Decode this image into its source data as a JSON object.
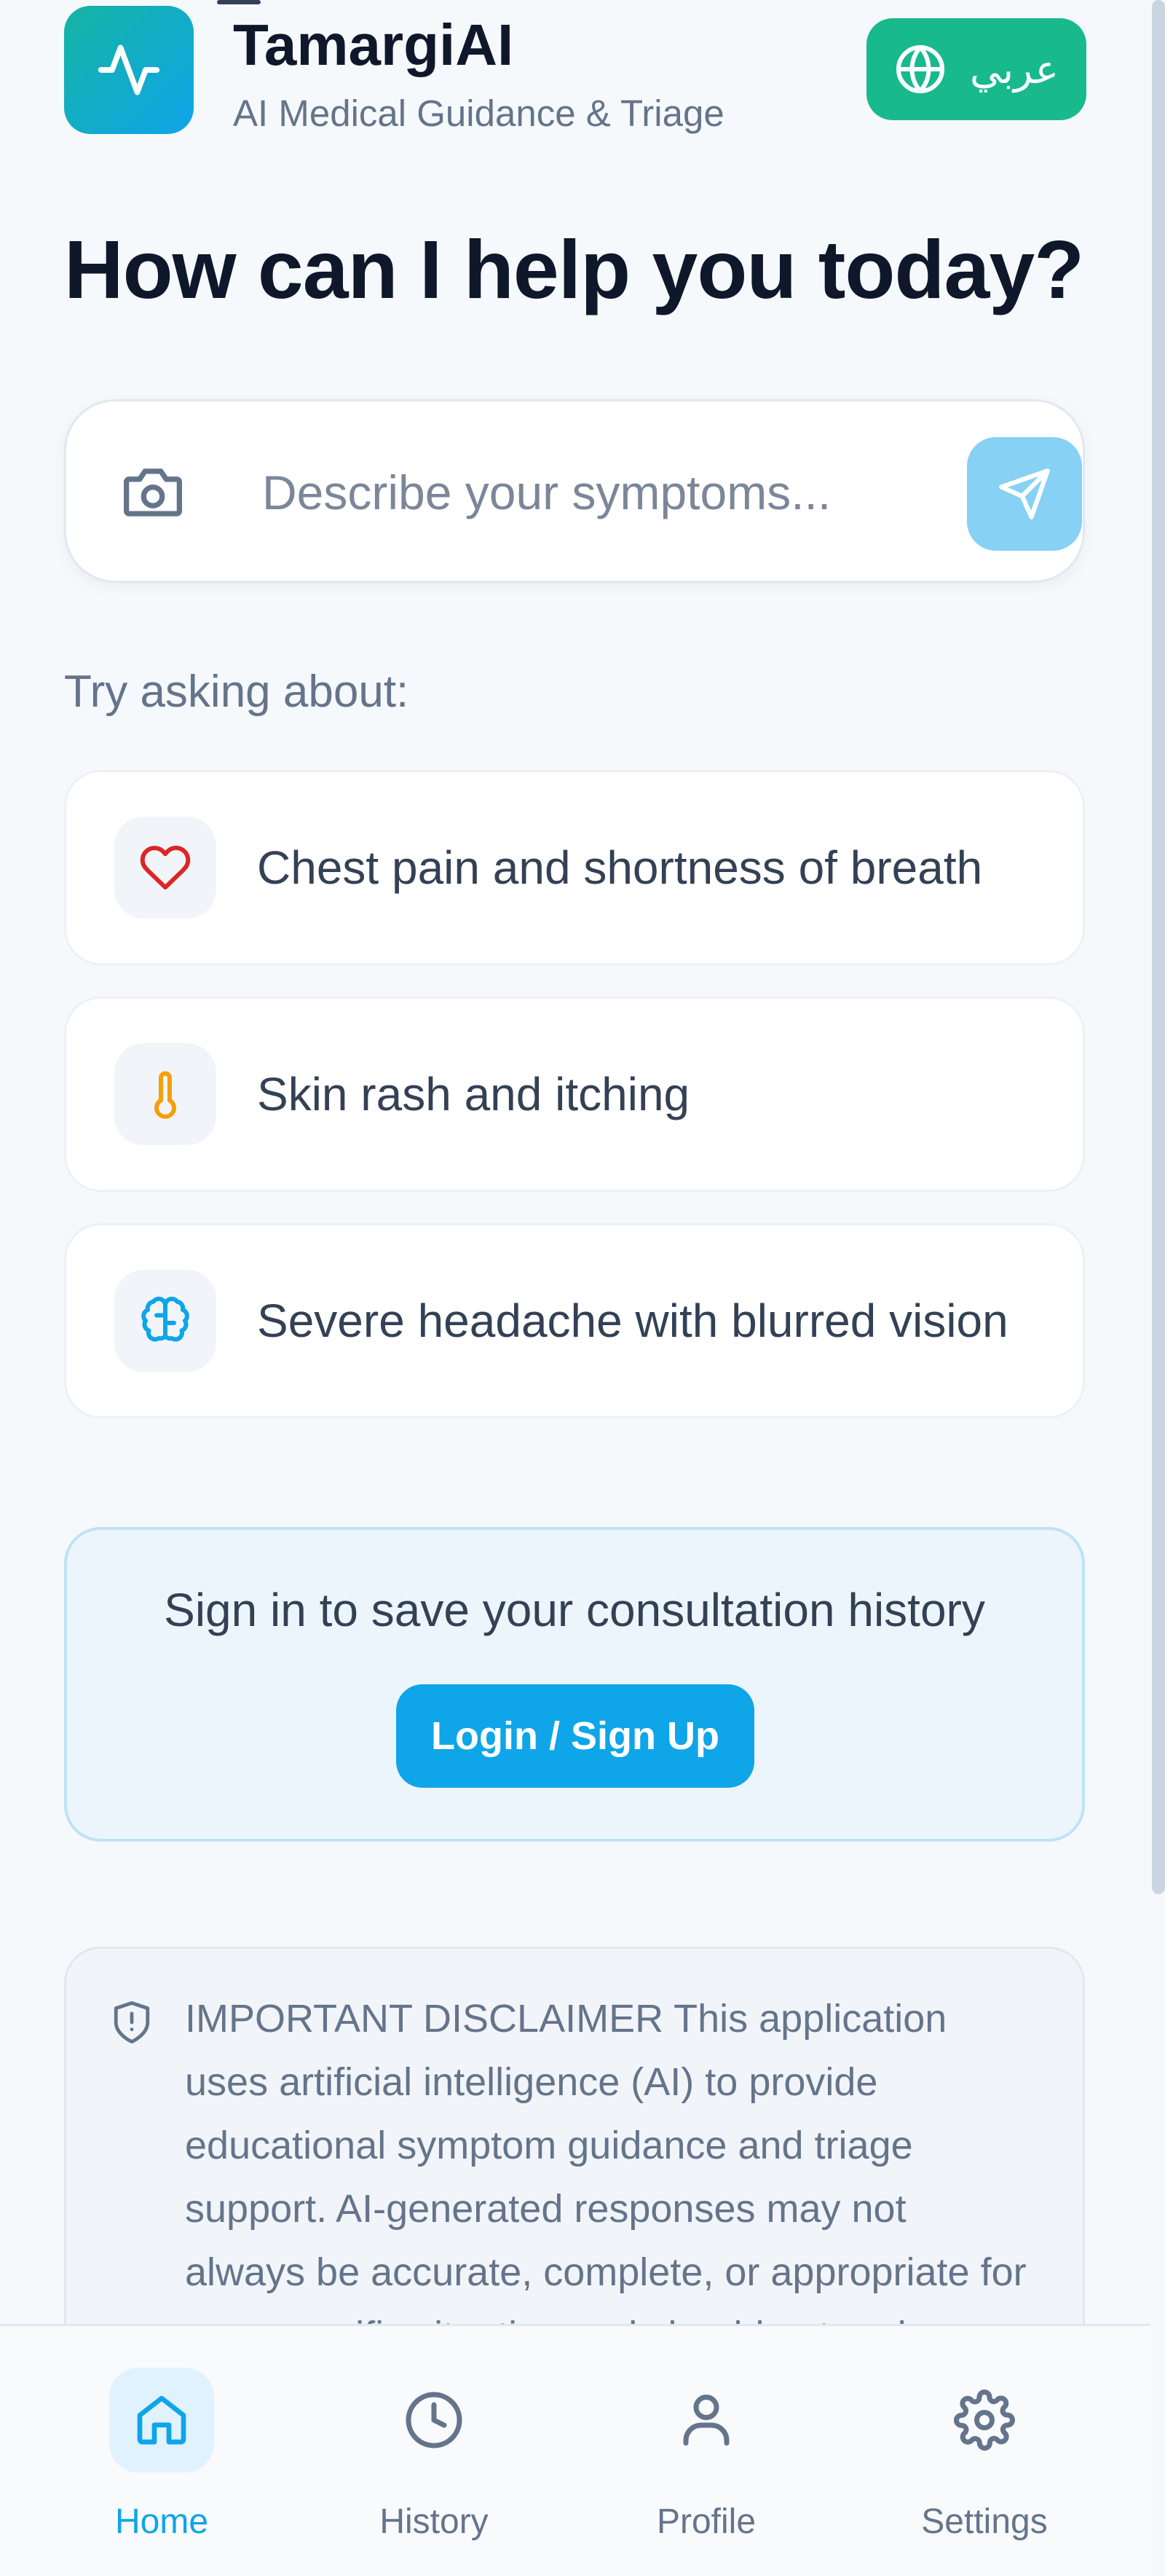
{
  "header": {
    "title": "TamargiAI",
    "subtitle": "AI Medical Guidance & Triage",
    "language_button": "عربي"
  },
  "main": {
    "heading": "How can I help you today?",
    "search": {
      "placeholder": "Describe your symptoms..."
    },
    "try_label": "Try asking about:",
    "suggestions": [
      {
        "label": "Chest pain and shortness of breath",
        "icon": "heart-icon",
        "color": "#dc2626"
      },
      {
        "label": "Skin rash and itching",
        "icon": "thermometer-icon",
        "color": "#f59e0b"
      },
      {
        "label": "Severe headache with blurred vision",
        "icon": "brain-icon",
        "color": "#0ea5e9"
      }
    ]
  },
  "signin": {
    "text": "Sign in to save your consultation history",
    "button": "Login / Sign Up"
  },
  "disclaimer": {
    "text": "IMPORTANT DISCLAIMER This application uses artificial intelligence (AI) to provide educational symptom guidance and triage support. AI-generated responses may not always be accurate, complete, or appropriate for your specific situation and should not replace professional medical advice."
  },
  "bottom_nav": {
    "items": [
      {
        "label": "Home",
        "icon": "home-icon",
        "active": true
      },
      {
        "label": "History",
        "icon": "clock-icon",
        "active": false
      },
      {
        "label": "Profile",
        "icon": "user-icon",
        "active": false
      },
      {
        "label": "Settings",
        "icon": "gear-icon",
        "active": false
      }
    ]
  },
  "colors": {
    "accent": "#0ea5e9",
    "language_button": "#19b98e",
    "send_button": "#86d1f4",
    "heading_text": "#0f172a",
    "muted_text": "#64748b"
  }
}
